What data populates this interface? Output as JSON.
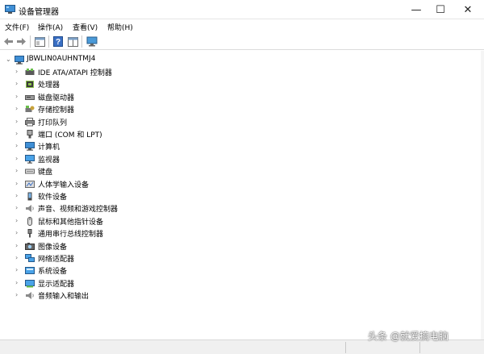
{
  "window": {
    "title": "设备管理器",
    "icon": "device-manager-icon",
    "minimize_glyph": "—",
    "maximize_glyph": "☐",
    "close_glyph": "✕"
  },
  "menu": [
    {
      "label": "文件(F)"
    },
    {
      "label": "操作(A)"
    },
    {
      "label": "查看(V)"
    },
    {
      "label": "帮助(H)"
    }
  ],
  "toolbar": {
    "buttons": [
      "back-arrow-icon",
      "forward-arrow-icon",
      "properties-icon",
      "help-icon",
      "view-panel-icon",
      "monitor-scan-icon"
    ]
  },
  "tree": {
    "root": {
      "label": "JBWLIN0AUHNTMJ4",
      "expanded": true,
      "icon": "computer-icon"
    },
    "children": [
      {
        "label": "IDE ATA/ATAPI 控制器",
        "icon": "ide-controller-icon"
      },
      {
        "label": "处理器",
        "icon": "processor-icon"
      },
      {
        "label": "磁盘驱动器",
        "icon": "disk-drive-icon"
      },
      {
        "label": "存储控制器",
        "icon": "storage-controller-icon"
      },
      {
        "label": "打印队列",
        "icon": "printer-icon"
      },
      {
        "label": "端口 (COM 和 LPT)",
        "icon": "port-icon"
      },
      {
        "label": "计算机",
        "icon": "computer-icon"
      },
      {
        "label": "监视器",
        "icon": "monitor-icon"
      },
      {
        "label": "键盘",
        "icon": "keyboard-icon"
      },
      {
        "label": "人体学输入设备",
        "icon": "hid-icon"
      },
      {
        "label": "软件设备",
        "icon": "software-device-icon"
      },
      {
        "label": "声音、视频和游戏控制器",
        "icon": "sound-icon"
      },
      {
        "label": "鼠标和其他指针设备",
        "icon": "mouse-icon"
      },
      {
        "label": "通用串行总线控制器",
        "icon": "usb-icon"
      },
      {
        "label": "图像设备",
        "icon": "camera-icon"
      },
      {
        "label": "网络适配器",
        "icon": "network-adapter-icon"
      },
      {
        "label": "系统设备",
        "icon": "system-device-icon"
      },
      {
        "label": "显示适配器",
        "icon": "display-adapter-icon"
      },
      {
        "label": "音频输入和输出",
        "icon": "audio-io-icon"
      }
    ]
  },
  "watermark": "头条 @就爱搞电脑",
  "colors": {
    "accent": "#2b6cb8",
    "tree_expander": "#6b6b6b",
    "statusbar": "#f0f0f0"
  }
}
